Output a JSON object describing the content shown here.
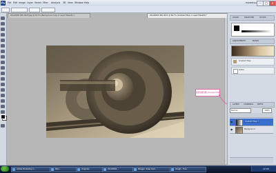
{
  "app": {
    "logo": "Ps",
    "menus": [
      "File",
      "Edit",
      "Image",
      "Layer",
      "Select",
      "Filter",
      "Analysis",
      "3D",
      "View",
      "Window",
      "Help"
    ],
    "workspace_label": "ESSENTIALS ▾"
  },
  "document_tabs": [
    {
      "label": "20120804 IMG 0025.jpg @ 66.7% (Background copy 2, Layer Mask/8) ×"
    },
    {
      "label": "20120804 IMG 0031 @ 66.7% (Gradient Map 1, Layer Mask/8) *"
    }
  ],
  "annotation": {
    "text": "選擇漸層對應 (Gradient Map)"
  },
  "right_panel": {
    "color_tabs": [
      "COLOR",
      "SWATCHES",
      "STYLES"
    ],
    "adjust_tabs": [
      "ADJUSTMENTS",
      "MASKS"
    ],
    "adjust_rows": [
      {
        "label": "Gradient Map"
      },
      {
        "label": "Dither"
      }
    ],
    "layers_tabs": [
      "LAYERS",
      "CHANNELS",
      "PATHS"
    ],
    "blend_mode": "Normal",
    "opacity": "100%",
    "layers": [
      {
        "name": "Gradient Map 1"
      },
      {
        "name": "Background"
      }
    ]
  },
  "taskbar": {
    "items": [
      {
        "label": "Adobe Photoshop C..."
      },
      {
        "label": "Bloc..."
      },
      {
        "label": "Originals"
      },
      {
        "label": "20120804..."
      },
      {
        "label": "Blogger: Soap Gom..."
      },
      {
        "label": "Snaglt - Flow"
      }
    ],
    "clock": "12:00"
  }
}
